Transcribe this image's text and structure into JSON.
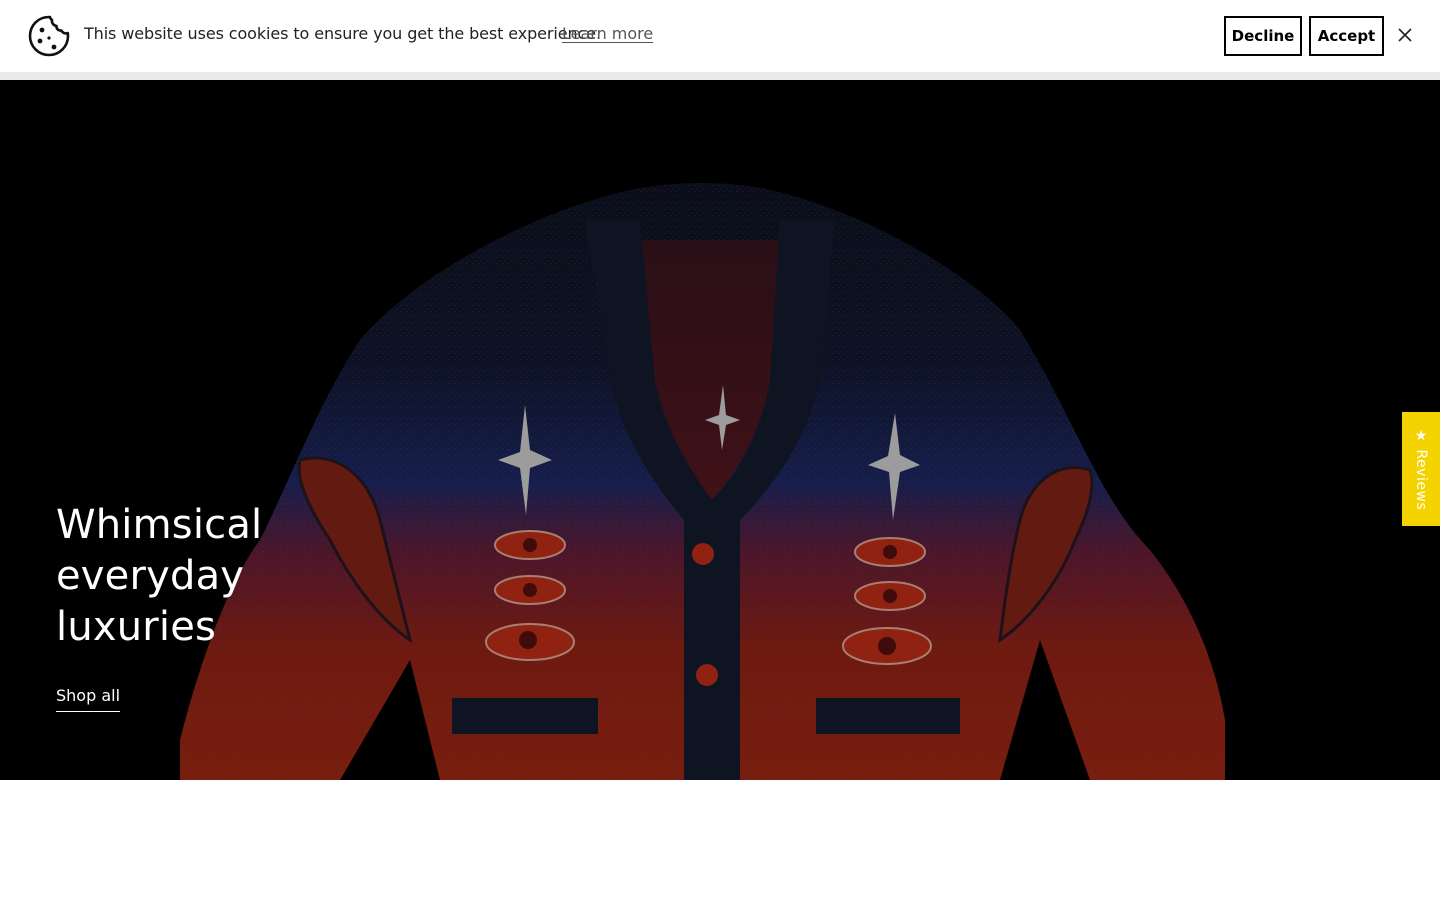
{
  "cookie_banner": {
    "message": "This website uses cookies to ensure you get the best experience.",
    "learn_more": "Learn more",
    "decline_label": "Decline",
    "accept_label": "Accept",
    "icons": {
      "cookie": "cookie-icon",
      "close": "close-icon"
    }
  },
  "hero": {
    "title": "Whimsical everyday luxuries",
    "cta_label": "Shop all",
    "image": "cardigan-with-eyes-and-stars"
  },
  "reviews_tab": {
    "label": "★ Reviews",
    "color": "#f5d300"
  }
}
